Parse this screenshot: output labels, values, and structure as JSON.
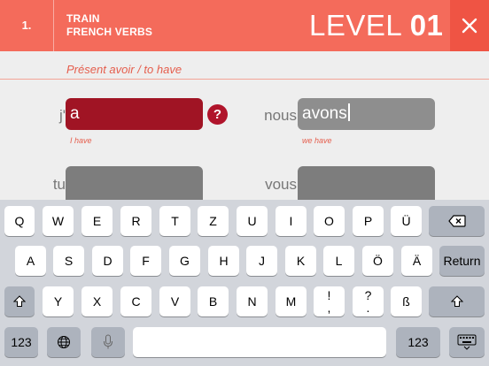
{
  "header": {
    "step_number": "1.",
    "title_line1": "TRAIN",
    "title_line2": "FRENCH VERBS",
    "level_label": "LEVEL",
    "level_number": "01",
    "close_icon": "close-icon",
    "bg_color": "#f46b5b"
  },
  "exercise": {
    "subtitle": "Présent avoir / to have",
    "conjugations": [
      {
        "pronoun": "j'",
        "value": "a",
        "hint": "I have",
        "state": "incorrect"
      },
      {
        "pronoun": "nous",
        "value": "avons",
        "hint": "we have",
        "state": "editing"
      },
      {
        "pronoun": "tu",
        "value": "",
        "hint": "",
        "state": "empty"
      },
      {
        "pronoun": "vous",
        "value": "",
        "hint": "",
        "state": "empty"
      }
    ],
    "help_button": "?",
    "error_color": "#a01424"
  },
  "keyboard": {
    "row1": [
      "Q",
      "W",
      "E",
      "R",
      "T",
      "Z",
      "U",
      "I",
      "O",
      "P",
      "Ü"
    ],
    "row2": [
      "A",
      "S",
      "D",
      "F",
      "G",
      "H",
      "J",
      "K",
      "L",
      "Ö",
      "Ä"
    ],
    "row3": [
      "Y",
      "X",
      "C",
      "V",
      "B",
      "N",
      "M",
      "ß"
    ],
    "row3_punct": [
      {
        "top": "!",
        "bottom": ","
      },
      {
        "top": "?",
        "bottom": "."
      }
    ],
    "return_label": "Return",
    "numbers_label": "123",
    "icons": [
      "backspace-icon",
      "shift-icon",
      "globe-icon",
      "microphone-icon",
      "keyboard-dismiss-icon"
    ]
  }
}
